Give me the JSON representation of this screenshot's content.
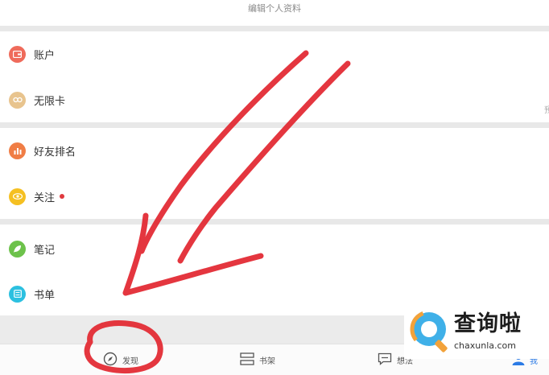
{
  "header": {
    "edit_profile": "编辑个人资料"
  },
  "groups": [
    {
      "items": [
        {
          "label": "账户",
          "icon": "wallet-icon",
          "color": "#ef6b5b"
        },
        {
          "label": "无限卡",
          "icon": "card-icon",
          "color": "#e8c48e"
        }
      ]
    },
    {
      "items": [
        {
          "label": "好友排名",
          "icon": "ranking-icon",
          "color": "#f07d45"
        },
        {
          "label": "关注",
          "icon": "eye-icon",
          "color": "#f5c022",
          "has_dot": true
        }
      ]
    },
    {
      "items": [
        {
          "label": "笔记",
          "icon": "leaf-icon",
          "color": "#6dc24b"
        },
        {
          "label": "书单",
          "icon": "booklist-icon",
          "color": "#2cc0e0"
        }
      ]
    }
  ],
  "right_hint": "预",
  "tabbar": {
    "tabs": [
      {
        "label": "发现",
        "icon": "compass-icon"
      },
      {
        "label": "书架",
        "icon": "bookshelf-icon"
      },
      {
        "label": "想法",
        "icon": "comment-icon"
      },
      {
        "label": "我",
        "icon": "profile-icon",
        "active": true
      }
    ]
  },
  "watermark": {
    "title": "查询啦",
    "subtitle": "chaxunla.com"
  },
  "colors": {
    "annotation_red": "#e2262f",
    "accent_blue": "#2c7be5"
  }
}
